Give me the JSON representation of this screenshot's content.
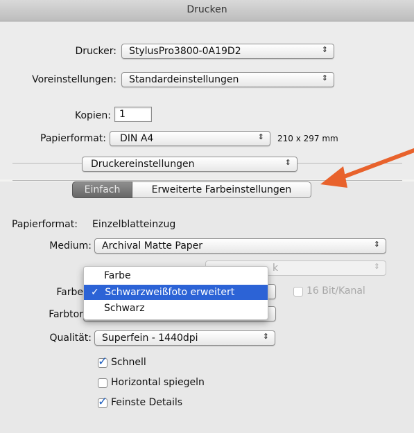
{
  "window": {
    "title": "Drucken"
  },
  "printer": {
    "label": "Drucker:",
    "value": "StylusPro3800-0A19D2"
  },
  "presets": {
    "label": "Voreinstellungen:",
    "value": "Standardeinstellungen"
  },
  "copies": {
    "label": "Kopien:",
    "value": "1"
  },
  "paper": {
    "label": "Papierformat:",
    "value": "DIN A4",
    "size_text": "210 x 297 mm"
  },
  "section": {
    "value": "Druckereinstellungen"
  },
  "tabs": {
    "basic": "Einfach",
    "advanced": "Erweiterte Farbeinstellungen"
  },
  "paper_source": {
    "label": "Papierformat:",
    "value": "Einzelblatteinzug"
  },
  "medium": {
    "label": "Medium:",
    "value": "Archival Matte Paper"
  },
  "ink": {
    "partial_value": "k"
  },
  "color": {
    "label": "Farbe",
    "bit_label": "16 Bit/Kanal"
  },
  "tone": {
    "label": "Farbtor"
  },
  "quality": {
    "label": "Qualität:",
    "value": "Superfein - 1440dpi"
  },
  "options": {
    "fast": "Schnell",
    "mirror": "Horizontal spiegeln",
    "finest": "Feinste Details"
  },
  "menu": {
    "items": [
      "Farbe",
      "Schwarzweißfoto erweitert",
      "Schwarz"
    ],
    "check": "✓"
  },
  "icons": {
    "updown": "updown-arrows-icon",
    "check": "checkmark-icon",
    "annotation": "orange-arrow"
  },
  "colors": {
    "accent": "#2c63d6",
    "annotation_arrow": "#e8622c"
  }
}
